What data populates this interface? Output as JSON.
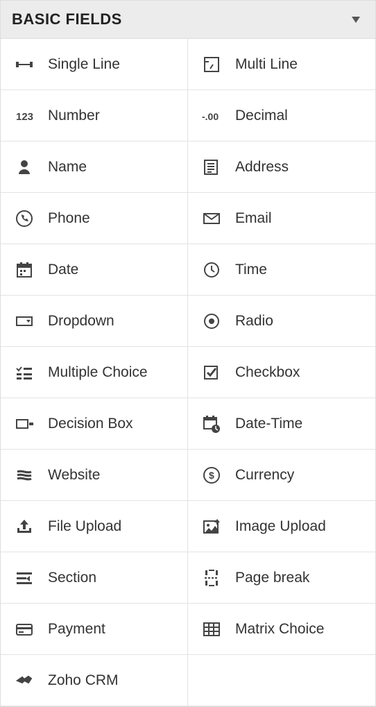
{
  "header": {
    "title": "BASIC FIELDS"
  },
  "fields": [
    {
      "label": "Single Line",
      "icon": "single-line-icon"
    },
    {
      "label": "Multi Line",
      "icon": "multi-line-icon"
    },
    {
      "label": "Number",
      "icon": "number-icon"
    },
    {
      "label": "Decimal",
      "icon": "decimal-icon"
    },
    {
      "label": "Name",
      "icon": "name-icon"
    },
    {
      "label": "Address",
      "icon": "address-icon"
    },
    {
      "label": "Phone",
      "icon": "phone-icon"
    },
    {
      "label": "Email",
      "icon": "email-icon"
    },
    {
      "label": "Date",
      "icon": "date-icon"
    },
    {
      "label": "Time",
      "icon": "time-icon"
    },
    {
      "label": "Dropdown",
      "icon": "dropdown-icon"
    },
    {
      "label": "Radio",
      "icon": "radio-icon"
    },
    {
      "label": "Multiple Choice",
      "icon": "multiple-choice-icon"
    },
    {
      "label": "Checkbox",
      "icon": "checkbox-icon"
    },
    {
      "label": "Decision Box",
      "icon": "decision-box-icon"
    },
    {
      "label": "Date-Time",
      "icon": "date-time-icon"
    },
    {
      "label": "Website",
      "icon": "website-icon"
    },
    {
      "label": "Currency",
      "icon": "currency-icon"
    },
    {
      "label": "File Upload",
      "icon": "file-upload-icon"
    },
    {
      "label": "Image Upload",
      "icon": "image-upload-icon"
    },
    {
      "label": "Section",
      "icon": "section-icon"
    },
    {
      "label": "Page break",
      "icon": "page-break-icon"
    },
    {
      "label": "Payment",
      "icon": "payment-icon"
    },
    {
      "label": "Matrix Choice",
      "icon": "matrix-choice-icon"
    },
    {
      "label": "Zoho CRM",
      "icon": "zoho-crm-icon"
    }
  ]
}
